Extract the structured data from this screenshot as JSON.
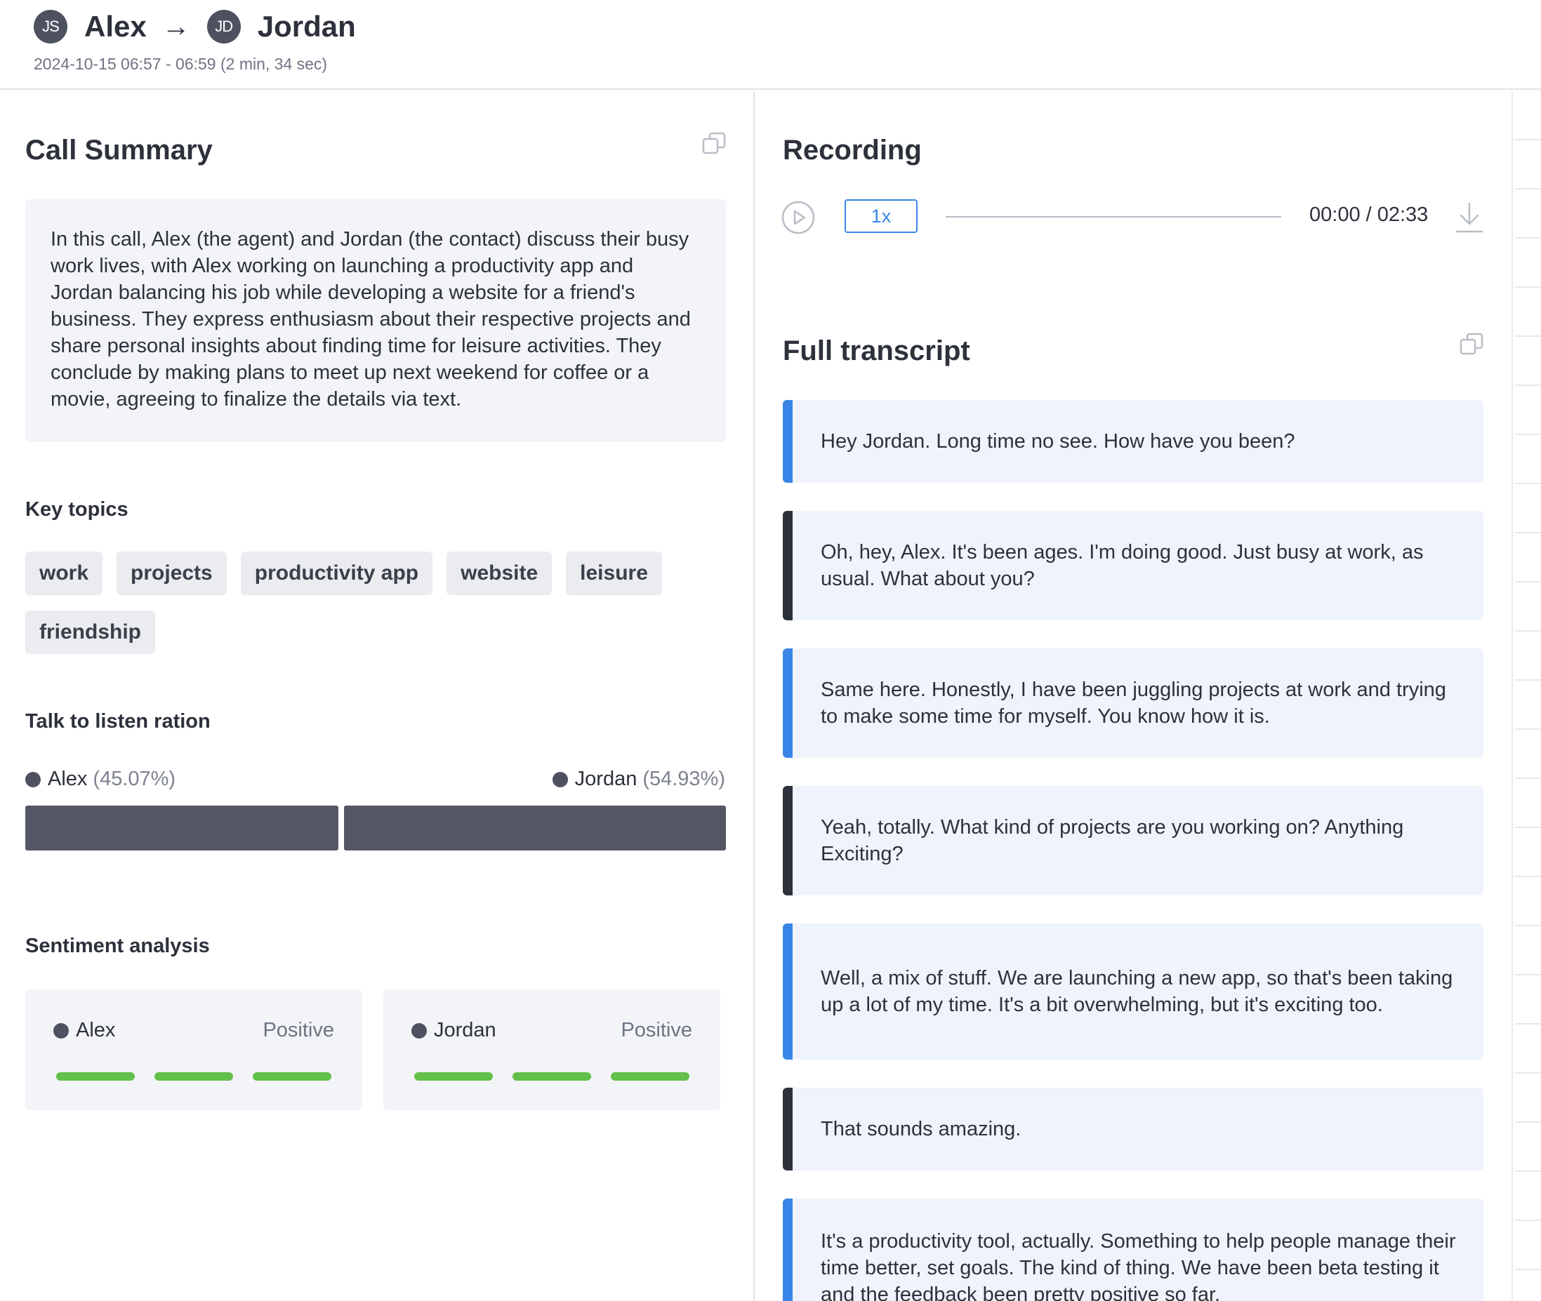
{
  "header": {
    "from_initials": "JS",
    "from_name": "Alex",
    "arrow": "→",
    "to_initials": "JD",
    "to_name": "Jordan",
    "datetime": "2024-10-15 06:57 - 06:59 (2 min, 34 sec)"
  },
  "summary": {
    "title": "Call Summary",
    "text": "In this call, Alex (the agent) and Jordan (the contact) discuss their busy work lives, with Alex working on launching a productivity app and Jordan balancing his job while developing a website for a friend's business. They express enthusiasm about their respective projects and share personal insights about finding time for leisure activities. They conclude by making plans to meet up next weekend for coffee or a movie, agreeing to finalize the details via text."
  },
  "key_topics": {
    "title": "Key topics",
    "items": [
      "work",
      "projects",
      "productivity app",
      "website",
      "leisure",
      "friendship"
    ]
  },
  "talk_ratio": {
    "title": "Talk to listen ration",
    "agent_name": "Alex",
    "agent_pct": "(45.07%)",
    "agent_value": 45.07,
    "contact_name": "Jordan",
    "contact_pct": "(54.93%)",
    "contact_value": 54.93
  },
  "sentiment": {
    "title": "Sentiment analysis",
    "agent": {
      "name": "Alex",
      "value": "Positive",
      "level": 3,
      "max": 3
    },
    "contact": {
      "name": "Jordan",
      "value": "Positive",
      "level": 3,
      "max": 3
    }
  },
  "recording": {
    "title": "Recording",
    "speed": "1x",
    "time": "00:00 / 02:33"
  },
  "transcript": {
    "title": "Full transcript",
    "messages": [
      {
        "speaker": "agent",
        "text": "Hey Jordan. Long time no see. How have you been?"
      },
      {
        "speaker": "contact",
        "text": "Oh, hey, Alex. It's been ages. I'm doing good. Just busy at work, as usual. What about you?"
      },
      {
        "speaker": "agent",
        "text": "Same here. Honestly, I have been juggling projects at work and trying to make some time for myself. You know how it is."
      },
      {
        "speaker": "contact",
        "text": "Yeah, totally. What kind of projects are you working on? Anything Exciting?"
      },
      {
        "speaker": "agent",
        "text": "Well, a mix of stuff. We are launching a new app, so that's been taking up a lot of my time. It's a bit overwhelming, but it's exciting too."
      },
      {
        "speaker": "contact",
        "text": "That sounds amazing."
      },
      {
        "speaker": "agent",
        "text": "It's a productivity tool, actually. Something to help people manage their time better, set goals. The kind of thing. We have been beta testing it and the feedback been pretty positive so far."
      }
    ]
  },
  "colors": {
    "agent_accent": "#3a86e8",
    "contact_accent": "#2d313b",
    "positive": "#62c04b"
  }
}
